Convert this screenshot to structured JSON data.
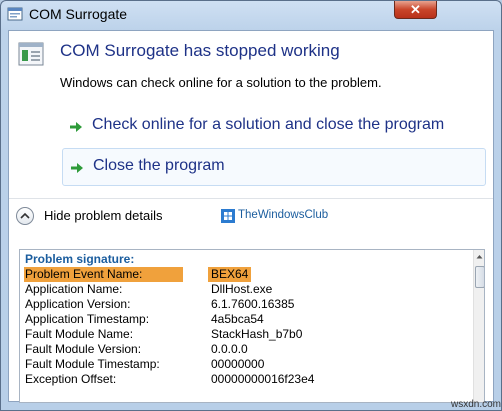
{
  "window": {
    "title": "COM Surrogate",
    "close_label": "✕"
  },
  "dialog": {
    "heading": "COM Surrogate has stopped working",
    "subtext": "Windows can check online for a solution to the problem.",
    "commands": [
      {
        "label": "Check online for a solution and close the program"
      },
      {
        "label": "Close the program"
      }
    ],
    "details_toggle": "Hide problem details"
  },
  "watermark": {
    "text": "TheWindowsClub"
  },
  "details": {
    "header": "Problem signature:",
    "rows": [
      {
        "key": "Problem Event Name:",
        "value": "BEX64"
      },
      {
        "key": "Application Name:",
        "value": "DllHost.exe"
      },
      {
        "key": "Application Version:",
        "value": "6.1.7600.16385"
      },
      {
        "key": "Application Timestamp:",
        "value": "4a5bca54"
      },
      {
        "key": "Fault Module Name:",
        "value": "StackHash_b7b0"
      },
      {
        "key": "Fault Module Version:",
        "value": "0.0.0.0"
      },
      {
        "key": "Fault Module Timestamp:",
        "value": "00000000"
      },
      {
        "key": "Exception Offset:",
        "value": "00000000016f23e4"
      }
    ]
  },
  "corner_watermark": "wsxdn.com",
  "colors": {
    "heading": "#1e3287",
    "highlight": "#f0a13c",
    "signature_header": "#1b5d9e",
    "arrow": "#2e9b3a"
  }
}
